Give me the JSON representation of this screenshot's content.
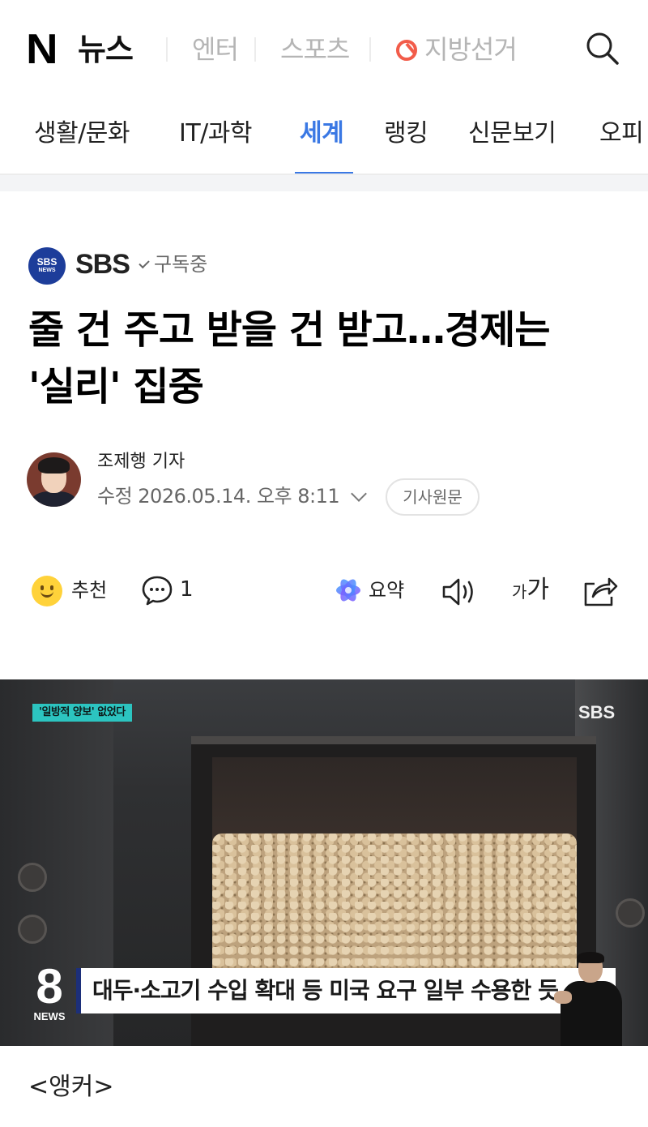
{
  "header": {
    "logo_n": "N",
    "logo_news": "뉴스",
    "links": [
      "엔터",
      "스포츠",
      "지방선거"
    ]
  },
  "tabs": [
    "생활/문화",
    "IT/과학",
    "세계",
    "랭킹",
    "신문보기",
    "오피"
  ],
  "active_tab": "세계",
  "press": {
    "logo_top": "SBS",
    "logo_bottom": "NEWS",
    "name": "SBS",
    "subscribed": "구독중"
  },
  "article": {
    "headline": "줄 건 주고 받을 건 받고…경제는 '실리' 집중",
    "author": "조제행 기자",
    "modified": "수정 2026.05.14. 오후 8:11",
    "original_label": "기사원문"
  },
  "actions": {
    "recommend_label": "추천",
    "comment_count": "1",
    "summary_label": "요약",
    "font_small": "가",
    "font_large": "가"
  },
  "video": {
    "tag": "'일방적 양보' 없었다",
    "broadcaster": "SBS",
    "program_num": "8",
    "program_label": "NEWS",
    "caption": "대두·소고기 수입 확대 등 미국 요구 일부 수용한 듯"
  },
  "body": {
    "first_line": "<앵커>"
  },
  "colors": {
    "accent": "#3a78e4",
    "election": "#f25c4a",
    "press_logo": "#1d3d9a",
    "tag": "#2cc4c0"
  }
}
